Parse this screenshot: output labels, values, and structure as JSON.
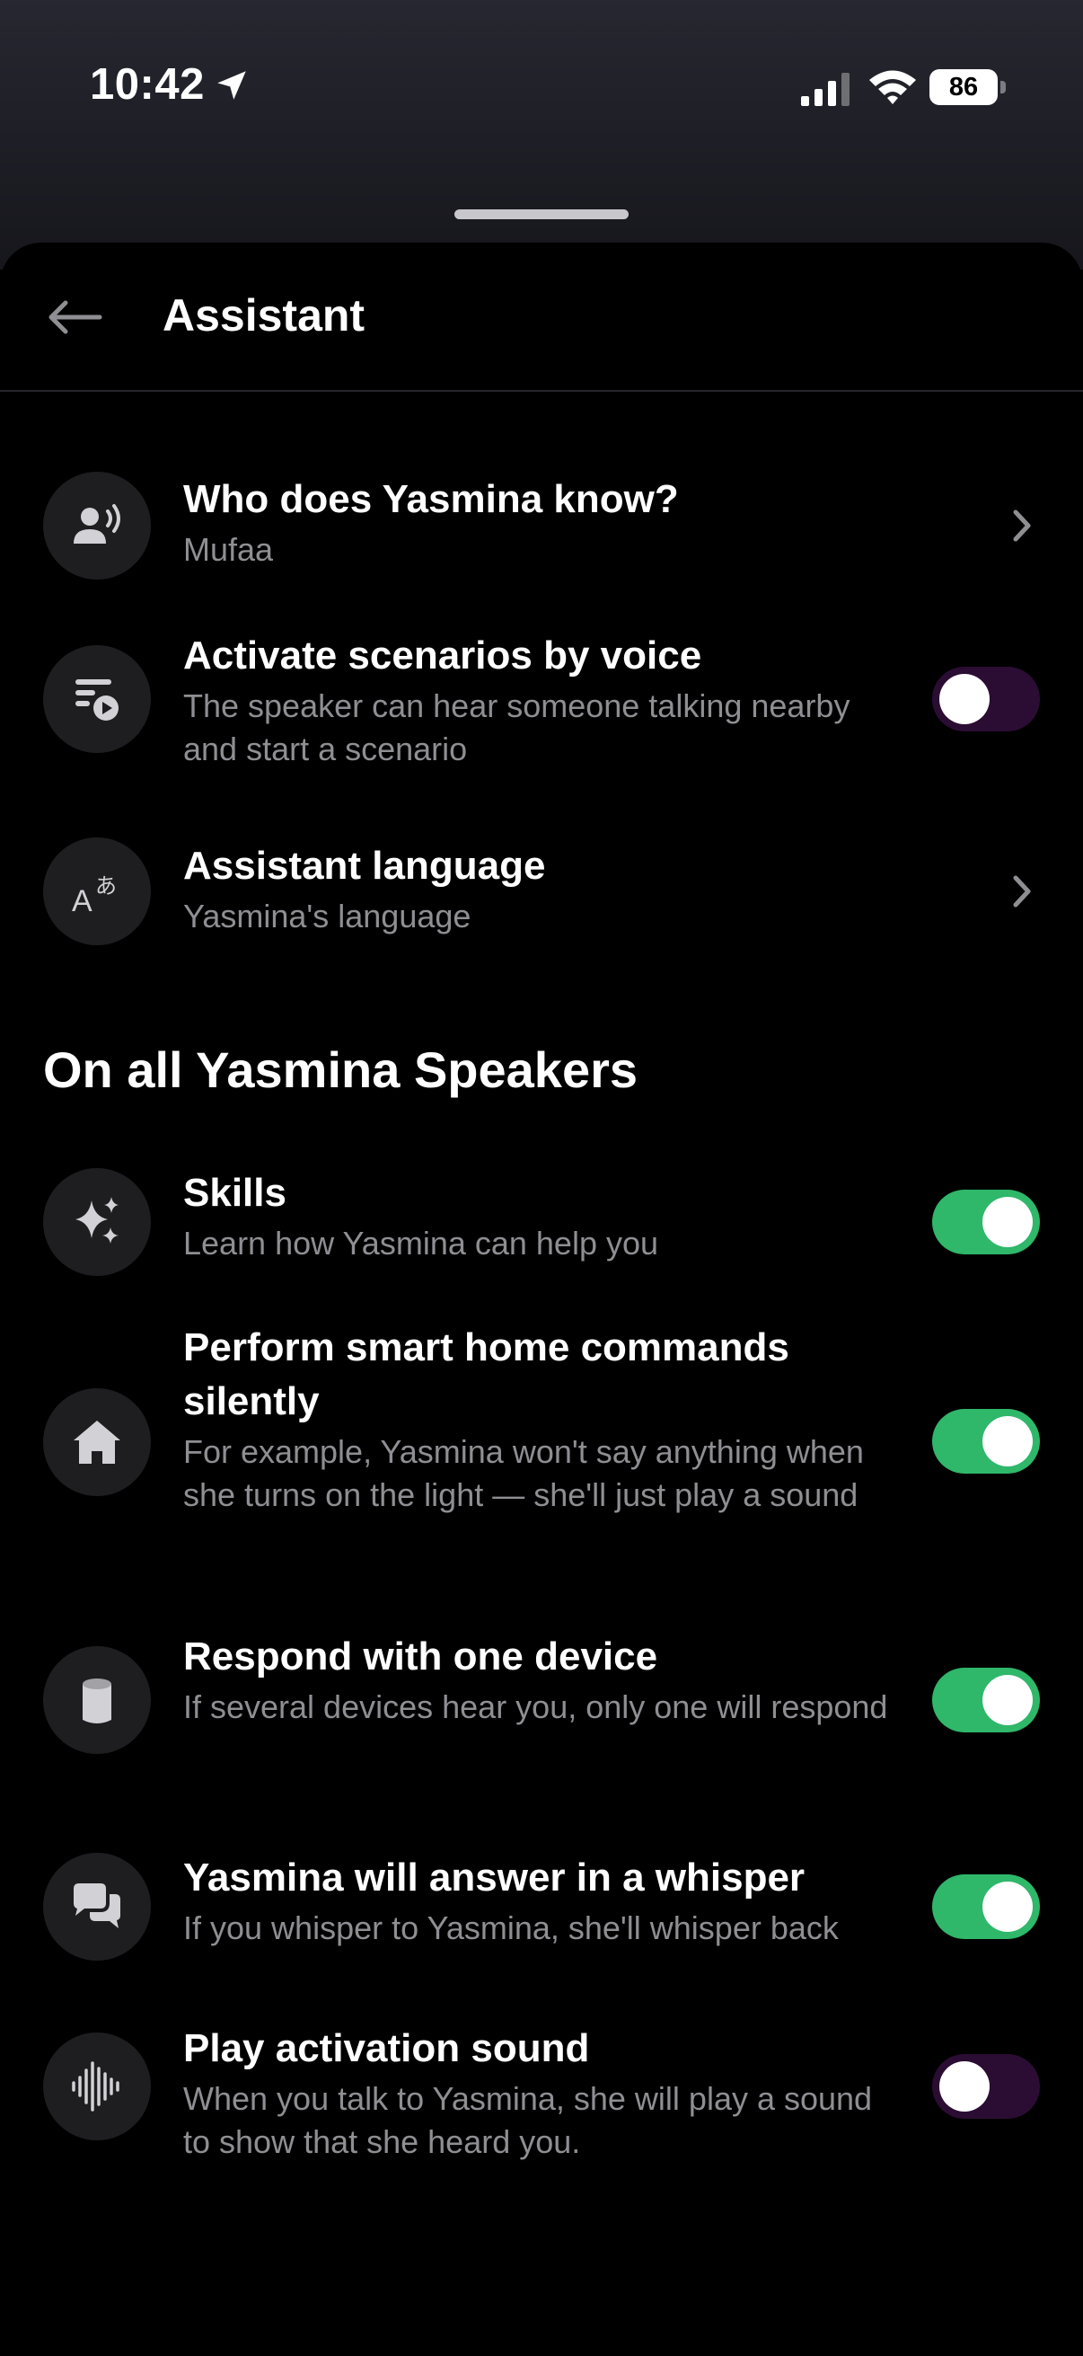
{
  "status_bar": {
    "time": "10:42",
    "battery": "86"
  },
  "header": {
    "title": "Assistant",
    "back_icon": "arrow-left-icon"
  },
  "top_items": [
    {
      "title": "Who does Yasmina know?",
      "subtitle": "Mufaa",
      "icon": "person-voice-icon",
      "control": "chevron"
    },
    {
      "title": "Activate scenarios by voice",
      "subtitle": "The speaker can hear someone talking nearby and start a scenario",
      "icon": "scenario-play-icon",
      "control": "toggle",
      "on": false
    },
    {
      "title": "Assistant language",
      "subtitle": "Yasmina's language",
      "icon": "language-icon",
      "control": "chevron"
    }
  ],
  "section": {
    "title": "On all Yasmina Speakers"
  },
  "speaker_items": [
    {
      "title": "Skills",
      "subtitle": "Learn how Yasmina can help you",
      "icon": "sparkles-icon",
      "on": true
    },
    {
      "title": "Perform smart home commands silently",
      "subtitle": "For example, Yasmina won't say anything when she turns on the light — she'll just play a sound",
      "icon": "home-icon",
      "on": true
    },
    {
      "title": "Respond with one device",
      "subtitle": "If several devices hear you, only one will respond",
      "icon": "speaker-device-icon",
      "on": true
    },
    {
      "title": "Yasmina will answer in a whisper",
      "subtitle": "If you whisper to Yasmina, she'll whisper back",
      "icon": "chat-bubbles-icon",
      "on": true
    },
    {
      "title": "Play activation sound",
      "subtitle": "When you talk to Yasmina, she will play a sound to show that she heard you.",
      "icon": "sound-wave-icon",
      "on": false
    }
  ],
  "colors": {
    "toggle_on": "#2fb76a",
    "toggle_off": "#2b0d33",
    "icon_bg": "#1e1e21",
    "subtitle": "#8e8e93"
  }
}
